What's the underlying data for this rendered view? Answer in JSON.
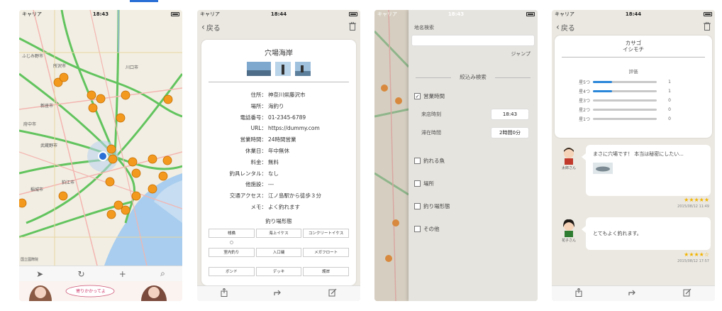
{
  "accent": "#2a6fd6",
  "status": {
    "carrier": "キャリア",
    "signal": "WiFi",
    "time": "18:43",
    "time_alt": "18:44"
  },
  "phone1": {
    "map_labels": [
      "ふじみ野市",
      "所沢市",
      "新座市",
      "府中市",
      "武蔵野市",
      "狛江市",
      "稲城市",
      "川口市",
      "国立國際院"
    ],
    "toolbar": [
      "➤",
      "↻",
      "+",
      "⌕"
    ],
    "banner_text": "寄りかかってよ"
  },
  "phone2": {
    "back_label": "戻る",
    "title": "穴場海岸",
    "info": [
      {
        "k": "住所：",
        "v": "神奈川県藤沢市"
      },
      {
        "k": "場所：",
        "v": "海釣り"
      },
      {
        "k": "電話番号：",
        "v": "01-2345-6789"
      },
      {
        "k": "URL：",
        "v": "https://dummy.com"
      },
      {
        "k": "営業時間：",
        "v": "24時間営業"
      },
      {
        "k": "休業日：",
        "v": "年中無休"
      },
      {
        "k": "料金：",
        "v": "無料"
      },
      {
        "k": "釣具レンタル：",
        "v": "なし"
      },
      {
        "k": "他施設：",
        "v": "---"
      },
      {
        "k": "交通アクセス：",
        "v": "江ノ島駅から徒歩３分"
      },
      {
        "k": "メモ：",
        "v": "よく釣れます"
      }
    ],
    "facility_title": "釣り場形態",
    "facility_row1": [
      "桟橋",
      "海上イケス",
      "コンクリートイケス"
    ],
    "facility_marks": [
      "○",
      "",
      ""
    ],
    "facility_row2": [
      "室内釣り",
      "入口磯",
      "メガフロート"
    ],
    "facility_row3": [
      "ボンド",
      "デッキ",
      "護岸"
    ]
  },
  "phone3": {
    "place_search_label": "地名検索",
    "jump_label": "ジャンプ",
    "filter_title": "絞込み検索",
    "business_hours": {
      "label": "営業時間",
      "checked": "✓"
    },
    "arrival_label": "来店時刻",
    "arrival_value": "18:43",
    "stay_label": "滞在時間",
    "stay_value": "2時間0分",
    "options": [
      "釣れる魚",
      "場所",
      "釣り場形態",
      "その他"
    ]
  },
  "phone4": {
    "back_label": "戻る",
    "fish_name": [
      "カサゴ",
      "イシモチ"
    ],
    "rating_title": "評価",
    "star_rows": [
      {
        "label": "星5つ",
        "count": "1",
        "fraction": 0.3
      },
      {
        "label": "星4つ",
        "count": "1",
        "fraction": 0.3
      },
      {
        "label": "星3つ",
        "count": "0",
        "fraction": 0
      },
      {
        "label": "星2つ",
        "count": "0",
        "fraction": 0
      },
      {
        "label": "星1つ",
        "count": "0",
        "fraction": 0
      }
    ],
    "reviews": [
      {
        "name": "太郎さん",
        "text": "まさに穴場です！ 本当は秘密にしたい...",
        "stars": "★★★★★",
        "date": "2015/08/12 11:49"
      },
      {
        "name": "花子さん",
        "text": "とてもよく釣れます。",
        "stars": "★★★★☆",
        "date": "2015/08/12 17:57"
      }
    ]
  }
}
